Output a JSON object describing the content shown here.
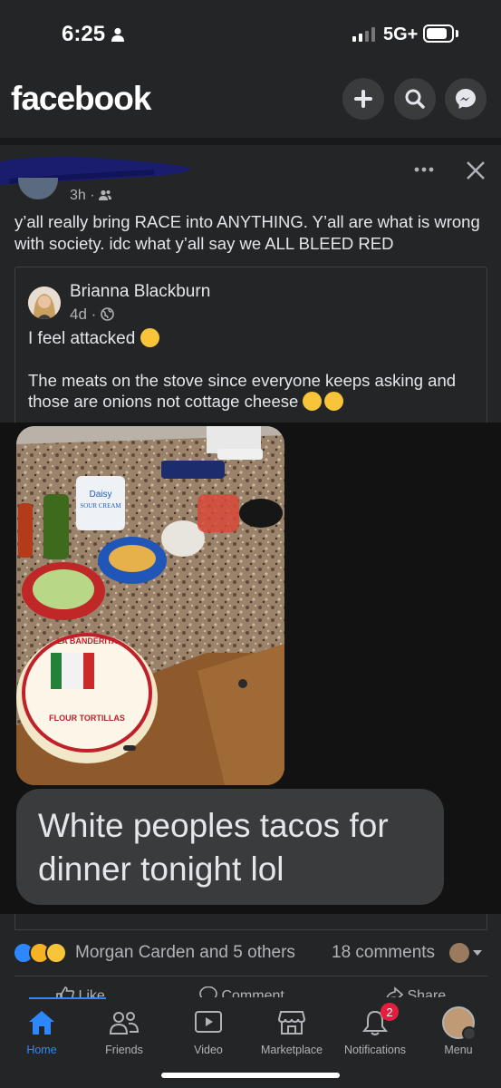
{
  "status_bar": {
    "time": "6:25",
    "network": "5G+"
  },
  "header": {
    "logo": "facebook",
    "icons": [
      "plus-icon",
      "search-icon",
      "messenger-icon"
    ]
  },
  "post": {
    "time": "3h",
    "audience_icon": "friends-icon",
    "text": "y’all really bring RACE into ANYTHING. Y’all are what is wrong with society. idc what y’all say we ALL BLEED RED",
    "shared": {
      "author": "Brianna Blackburn",
      "time": "4d",
      "audience_icon": "globe-icon",
      "line1": "I feel attacked",
      "line2": "The meats on the stove since everyone keeps asking and those are onions not cottage cheese",
      "caption": "White peoples tacos for dinner tonight lol",
      "photo_labels": {
        "sour_cream": "Daisy",
        "sour_cream_sub": "SOUR CREAM",
        "tortilla_brand": "LA BANDERITA",
        "tortilla_kind": "FLOUR TORTILLAS"
      }
    },
    "reactions": {
      "icons": [
        "like-icon",
        "care-icon",
        "haha-icon"
      ],
      "text": "Morgan Carden and 5 others",
      "comments": "18 comments"
    },
    "actions": [
      "Like",
      "Comment",
      "Share"
    ]
  },
  "tabbar": {
    "tabs": [
      {
        "label": "Home",
        "icon": "home-icon",
        "active": true
      },
      {
        "label": "Friends",
        "icon": "friends-icon"
      },
      {
        "label": "Video",
        "icon": "video-icon"
      },
      {
        "label": "Marketplace",
        "icon": "marketplace-icon"
      },
      {
        "label": "Notifications",
        "icon": "bell-icon"
      },
      {
        "label": "Menu",
        "icon": "profile-avatar"
      }
    ],
    "notifications_badge": "2"
  },
  "colors": {
    "accent": "#2d88ff",
    "background": "#242526",
    "badge": "#e41e3f"
  }
}
